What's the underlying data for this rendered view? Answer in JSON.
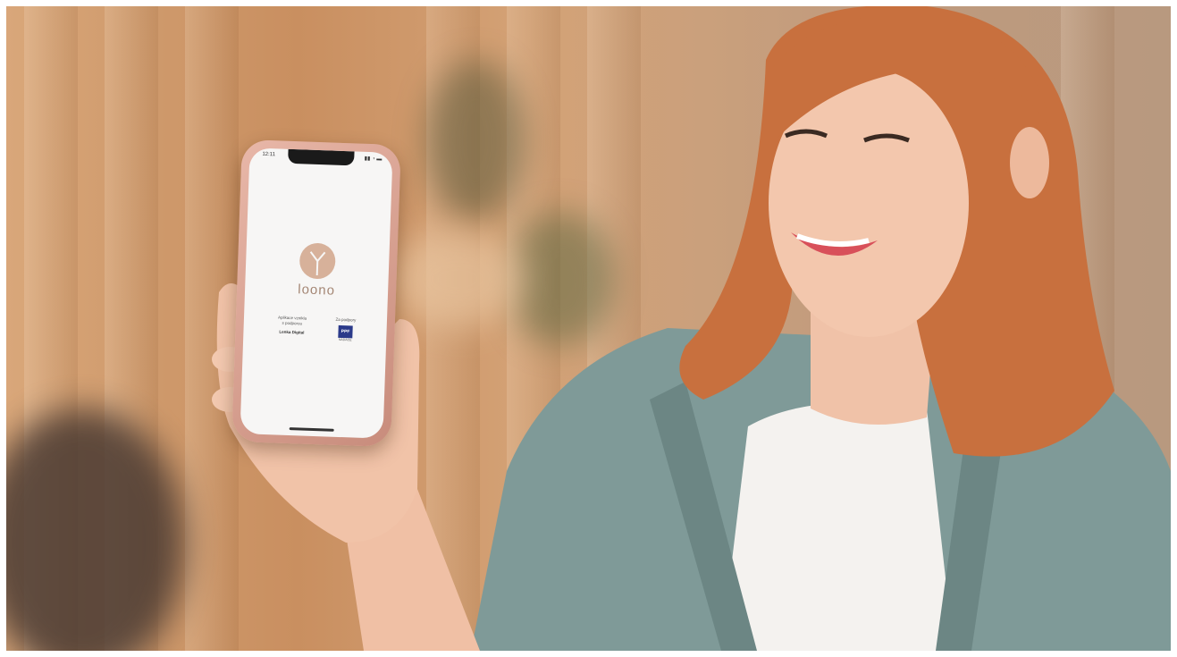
{
  "phone": {
    "status_time": "12:11",
    "status_icons": "▮▮ ◔ ▬",
    "app_name": "loono",
    "credit_left_line1": "Aplikace vznikla",
    "credit_left_line2": "s podporou",
    "credit_left_brand": "Lenka Digital",
    "credit_right_line1": "Za podpory",
    "credit_right_logo": "PPF",
    "credit_right_sub": "NADACE"
  },
  "colors": {
    "background": "#cf9a6c",
    "jacket": "#7f9a98",
    "hair": "#c8703e",
    "logo": "#d7b19a"
  }
}
